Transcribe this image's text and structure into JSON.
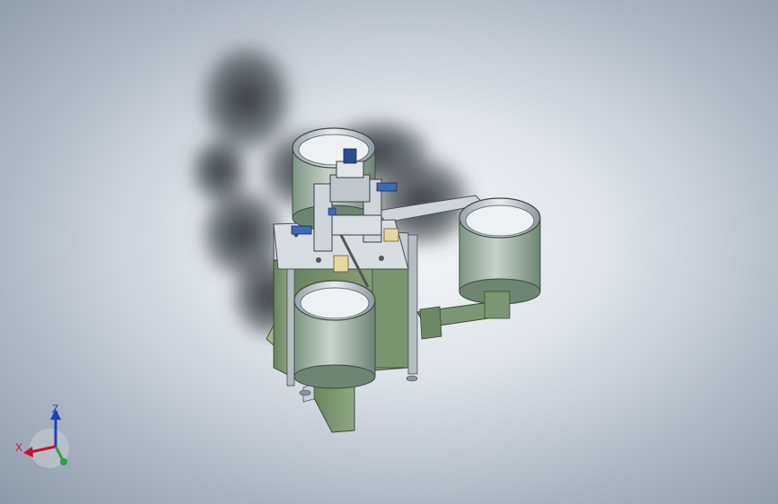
{
  "triad": {
    "z_label": "Z",
    "x_label": "X"
  },
  "colors": {
    "background_center": "#f4f6f8",
    "background_edge": "#8e9aa8",
    "frame_green": "#7f9872",
    "steel": "#b9c0c7",
    "axis_x": "#c8102e",
    "axis_y": "#2ea043",
    "axis_z": "#1f3fbf"
  },
  "model": {
    "parts": [
      "feeder-bowl-rear",
      "feeder-bowl-right",
      "feeder-bowl-front",
      "machine-table",
      "main-frame",
      "stand-leg",
      "linear-feeder-track",
      "side-bracket",
      "pick-and-place-unit"
    ]
  }
}
